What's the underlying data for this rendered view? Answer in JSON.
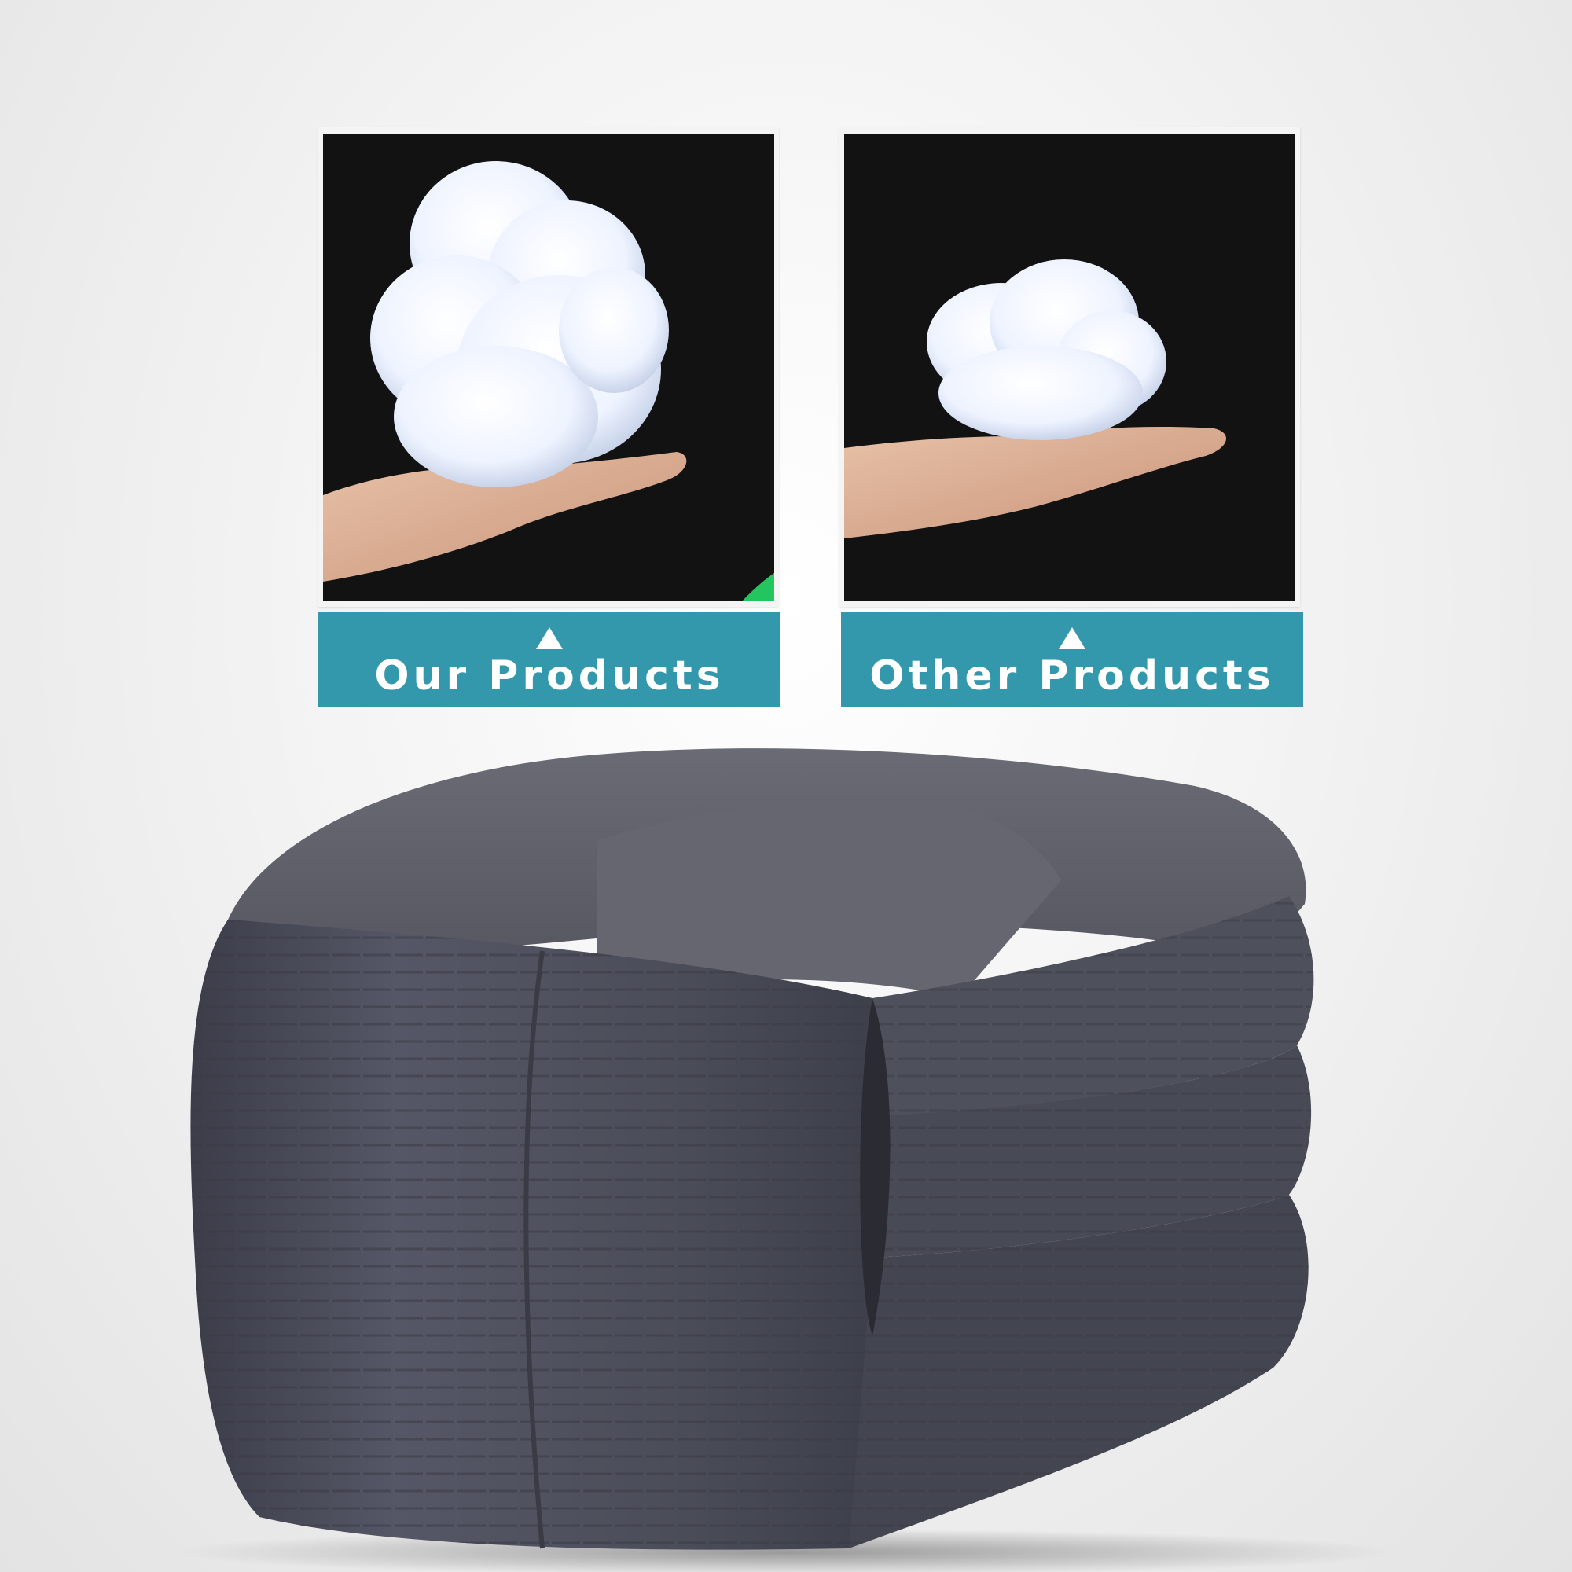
{
  "panels": [
    {
      "label": "Our Products",
      "marker": "up-triangle-icon",
      "badge": "checkmark-icon",
      "badge_color": "#22c55e"
    },
    {
      "label": "Other Products",
      "marker": "up-triangle-icon"
    }
  ],
  "colors": {
    "label_bar": "#3398ab",
    "photo_background": "#121212",
    "comforter": "#4b4d59"
  }
}
